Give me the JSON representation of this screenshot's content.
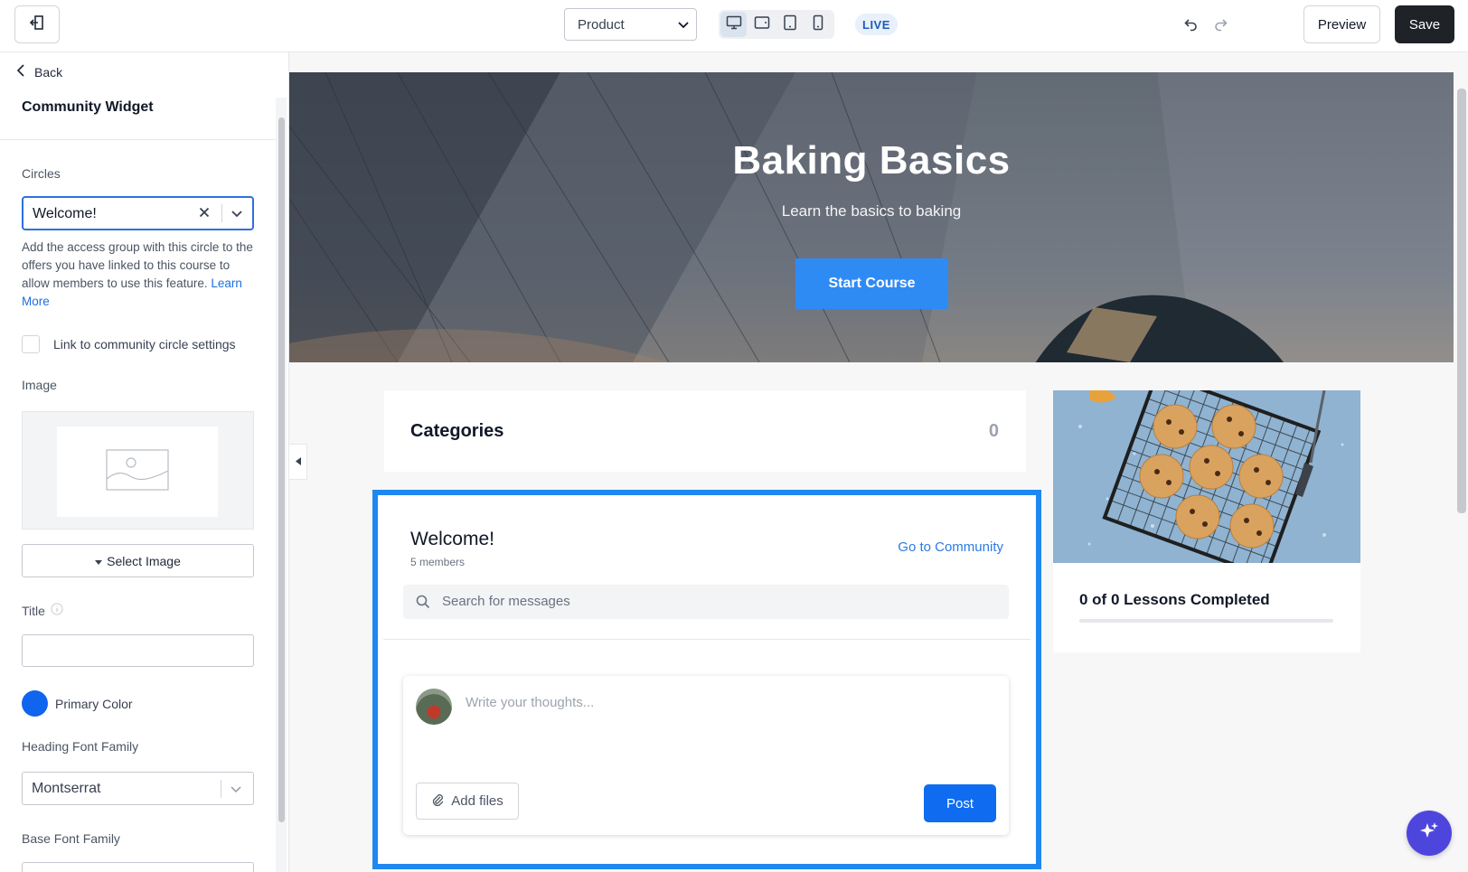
{
  "topbar": {
    "page_select_value": "Product",
    "live_badge": "LIVE",
    "preview_label": "Preview",
    "save_label": "Save",
    "active_device": "desktop",
    "devices": [
      "desktop",
      "tablet-landscape",
      "tablet-portrait",
      "mobile"
    ]
  },
  "sidebar": {
    "back_label": "Back",
    "widget_title": "Community Widget",
    "circles_label": "Circles",
    "circles_value": "Welcome!",
    "help_text": "Add the access group with this circle to the offers you have linked to this course to allow members to use this feature.",
    "learn_more": "Learn More",
    "link_checkbox_label": "Link to community circle settings",
    "link_checkbox_checked": false,
    "image_label": "Image",
    "select_image_label": "Select Image",
    "title_label": "Title",
    "title_value": "",
    "primary_color_label": "Primary Color",
    "primary_color": "#0f64f0",
    "heading_font_label": "Heading Font Family",
    "heading_font_value": "Montserrat",
    "base_font_label": "Base Font Family"
  },
  "hero": {
    "title": "Baking Basics",
    "subtitle": "Learn the basics to baking",
    "cta_label": "Start Course",
    "cta_color": "#2f8bf4"
  },
  "categories": {
    "title": "Categories",
    "count": "0"
  },
  "community": {
    "name": "Welcome!",
    "members": "5 members",
    "goto_label": "Go to Community",
    "search_placeholder": "Search for messages",
    "composer_placeholder": "Write your thoughts...",
    "add_files_label": "Add files",
    "post_label": "Post",
    "selection_color": "#1e88f0"
  },
  "course": {
    "lessons_completed": "0 of 0 Lessons Completed",
    "progress_fraction": 0
  }
}
